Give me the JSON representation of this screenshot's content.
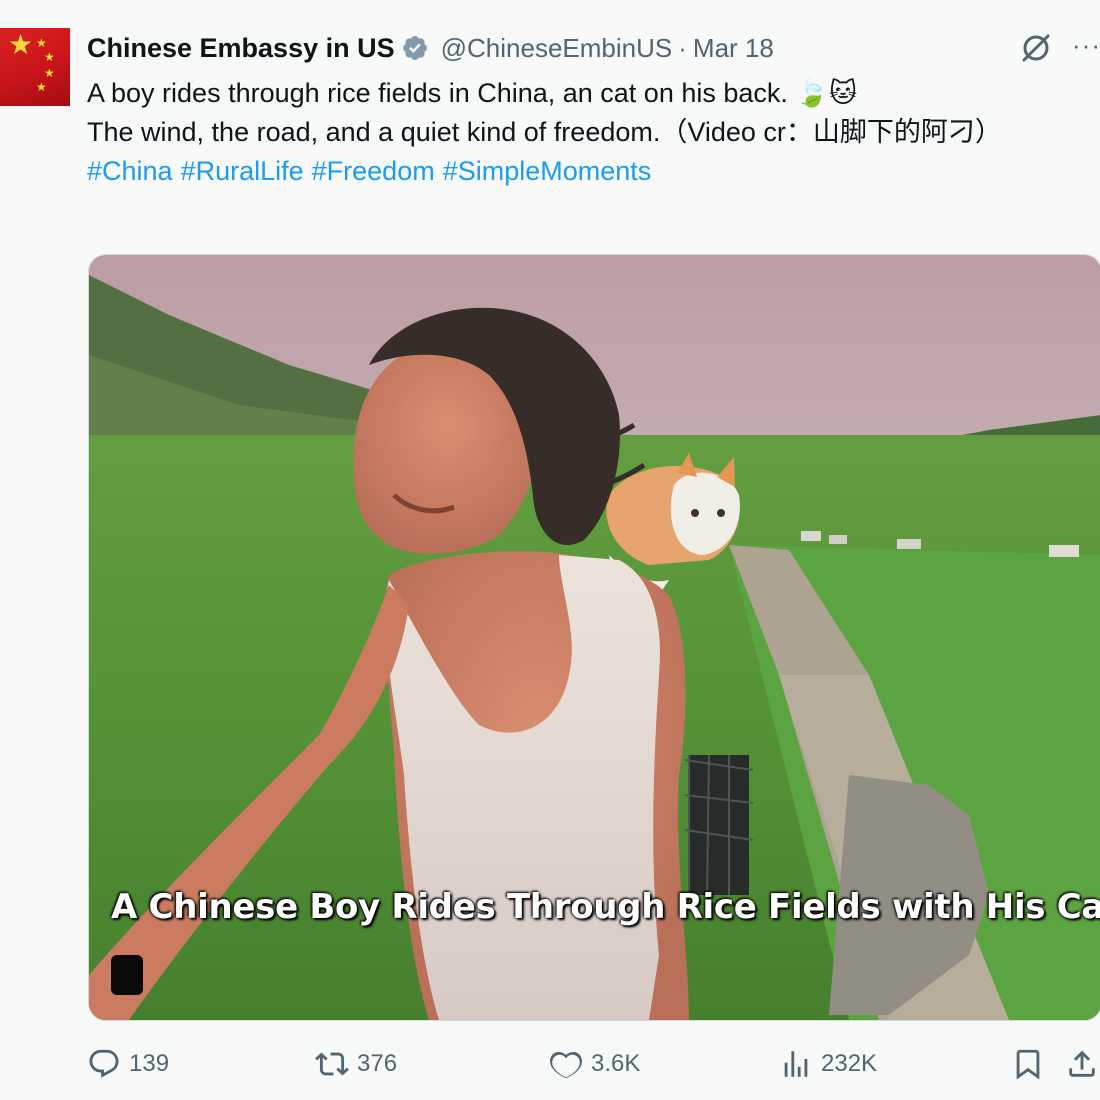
{
  "author": {
    "name": "Chinese Embassy in US",
    "handle": "@ChineseEmbinUS",
    "separator": "·",
    "date": "Mar 18"
  },
  "tweet": {
    "line1": "A boy rides through rice fields in China, an cat on his back. 🍃🐱",
    "line2": "The wind, the road, and a quiet kind of freedom.（Video cr：山脚下的阿刁）",
    "hashtags": [
      "#China",
      "#RuralLife",
      "#Freedom",
      "#SimpleMoments"
    ]
  },
  "media": {
    "caption": "A Chinese Boy Rides Through Rice Fields with His Cat"
  },
  "actions": {
    "replies": "139",
    "reposts": "376",
    "likes": "3.6K",
    "views": "232K"
  },
  "icons": {
    "more": "more-dots-icon",
    "grok": "grok-icon",
    "verified": "verified-badge-icon",
    "reply": "reply-icon",
    "repost": "repost-icon",
    "like": "heart-icon",
    "views": "views-icon",
    "bookmark": "bookmark-icon",
    "share": "share-icon"
  },
  "colors": {
    "link": "#1d9bf0",
    "secondary_text": "#536471",
    "verified": "#829aab"
  }
}
